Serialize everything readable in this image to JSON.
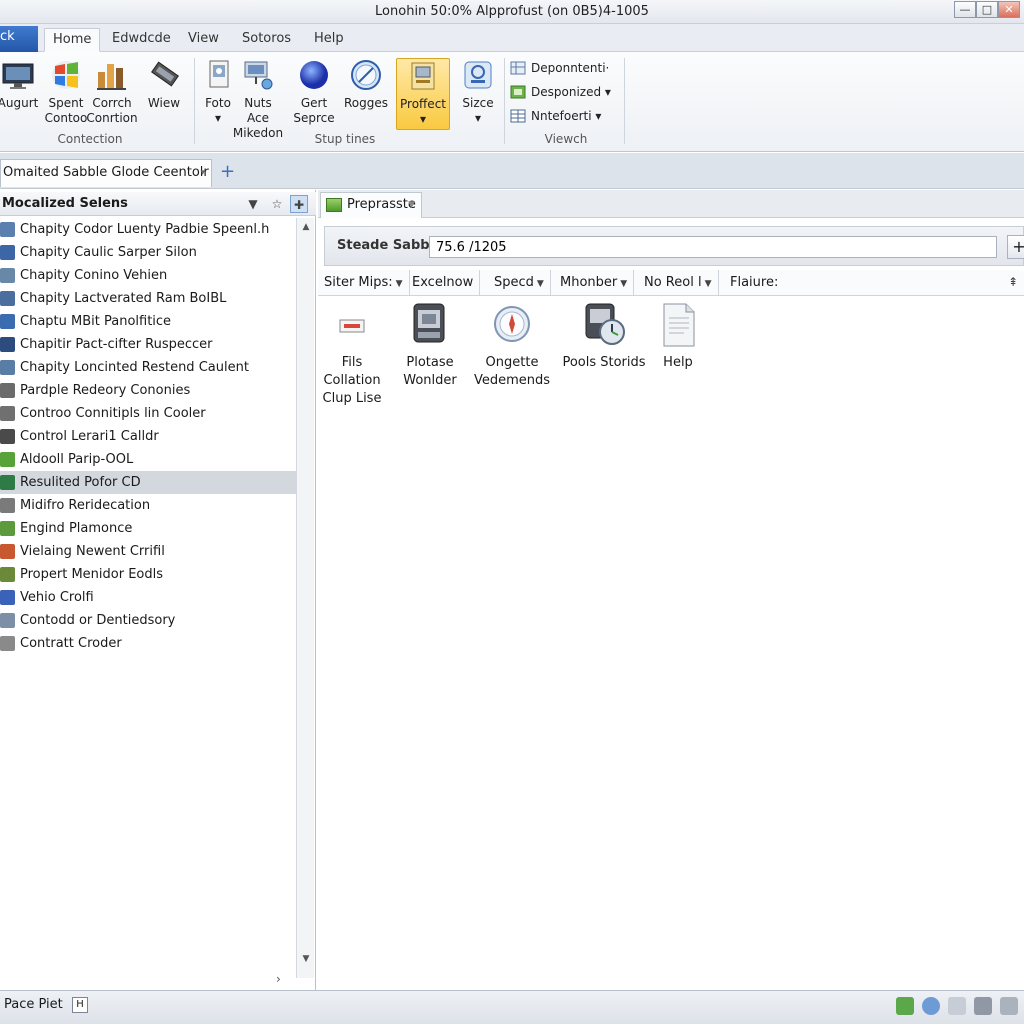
{
  "window": {
    "title": "Lonohin 50:0% Alpprofust (on 0B5)4-1005",
    "buttons": [
      "—",
      "□",
      "✕"
    ]
  },
  "ribbon_tabs": [
    "ck",
    "Home",
    "Edwdcde",
    "View",
    "Sotoros",
    "Help"
  ],
  "ribbon": {
    "buttons": [
      {
        "label": "Augurt",
        "icon": "monitor-icon"
      },
      {
        "label": "Spent\nContoo",
        "icon": "windows-logo-icon"
      },
      {
        "label": "Corrch\nConrtion",
        "icon": "bar-chart-icon"
      },
      {
        "label": "Wiew",
        "icon": "tools-icon"
      },
      {
        "label": "Foto\n▾",
        "icon": "photo-icon"
      },
      {
        "label": "Nuts Ace\nMikedon",
        "icon": "network-icon"
      },
      {
        "label": "Gert\nSeprce",
        "icon": "blue-sphere-icon"
      },
      {
        "label": "Rogges",
        "icon": "compass-icon"
      },
      {
        "label": "Proffect\n▾",
        "icon": "project-icon"
      },
      {
        "label": "Sizce\n▾",
        "icon": "size-icon"
      }
    ],
    "groups": [
      "Contection",
      "Stup tines",
      "Viewch"
    ],
    "small_buttons": [
      "Deponntenti·",
      "Desponized ▾",
      "Nntefoerti ▾"
    ]
  },
  "doc_tab": {
    "label": "Omaited Sabble Glode Ceentolr",
    "dropdown": "▾",
    "add": "+"
  },
  "left_panel": {
    "header": "Mocalized Selens",
    "header_dropdown": "▼",
    "items": [
      {
        "label": "Chapity Codor Luenty Padbie Speenl.h",
        "color": "#5b7fae"
      },
      {
        "label": "Chapity Caulic Sarper Silon",
        "color": "#3d66a6"
      },
      {
        "label": "Chapity Conino Vehien",
        "color": "#6888a8"
      },
      {
        "label": "Chapity Lactverated Ram BoIBL",
        "color": "#4a6f9e"
      },
      {
        "label": "Chaptu MBit Panolfitice",
        "color": "#3c6cb0"
      },
      {
        "label": "Chapitir Pact-cifter Ruspeccer",
        "color": "#2c4c80"
      },
      {
        "label": "Chapity Loncinted Restend Caulent",
        "color": "#5a7da6"
      },
      {
        "label": "Pardple Redeory Cononies",
        "color": "#6b6b6b"
      },
      {
        "label": "Controo Connitipls lin Cooler",
        "color": "#707070"
      },
      {
        "label": "Control Lerari1 Calldr",
        "color": "#4a4a4a"
      },
      {
        "label": "Aldooll Parip-OOL",
        "color": "#57a33a"
      },
      {
        "label": "Resulited Pofor CD",
        "color": "#2f7b46"
      },
      {
        "label": "Midifro Reridecation",
        "color": "#7a7a7a"
      },
      {
        "label": "Engind Plamonce",
        "color": "#5d9a3c"
      },
      {
        "label": "Vielaing Newent Crrifil",
        "color": "#c8582f"
      },
      {
        "label": "Propert Menidor Eodls",
        "color": "#6a8a3a"
      },
      {
        "label": "Vehio Crolfi",
        "color": "#3a62b8"
      },
      {
        "label": "Contodd or Dentiedsory",
        "color": "#7d8fa6"
      },
      {
        "label": "Contratt Croder",
        "color": "#8a8a8a"
      }
    ],
    "selected_index": 11
  },
  "right_panel": {
    "tab": "Preprasste",
    "field_label": "Steade Sabble",
    "field_value": "75.6 /1205",
    "field_plus": "+",
    "filters": [
      {
        "label": "Siter Mips:",
        "dropdown": true
      },
      {
        "label": "Excelnow",
        "dropdown": false
      },
      {
        "label": "Specd",
        "dropdown": true
      },
      {
        "label": "Mhonber",
        "dropdown": true
      },
      {
        "label": "No Reol l",
        "dropdown": true
      },
      {
        "label": "Flaiure:",
        "dropdown": false
      }
    ],
    "pin_icon": "pin-icon",
    "icons": [
      {
        "label": "Fils\nCollation\nClup Lise",
        "icon": "file-collation-icon"
      },
      {
        "label": "Plotase\nWonlder",
        "icon": "device-icon"
      },
      {
        "label": "Ongette\nVedemends",
        "icon": "compass-icon"
      },
      {
        "label": "Pools Storids",
        "icon": "clock-gauge-icon"
      },
      {
        "label": "Help",
        "icon": "document-icon"
      }
    ]
  },
  "status_bar": {
    "text": "Pace Piet",
    "button": "H"
  }
}
